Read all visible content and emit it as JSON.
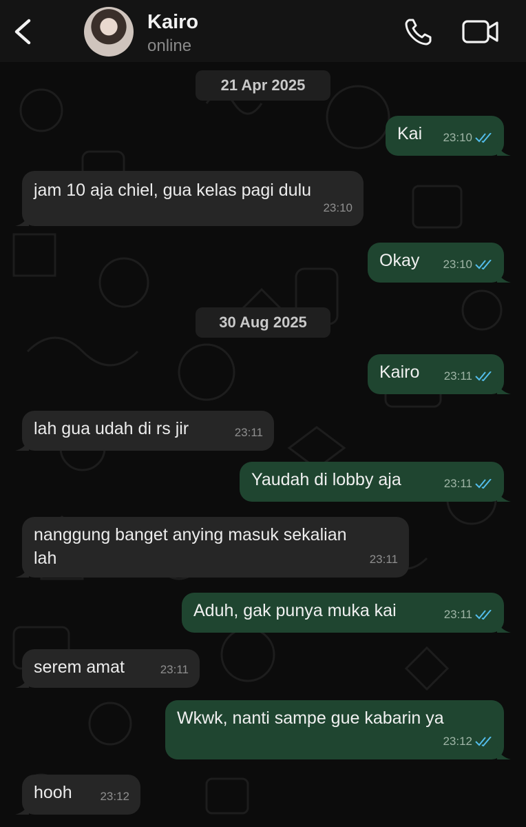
{
  "header": {
    "contact_name": "Kairo",
    "status": "online",
    "back_icon": "chevron-left-icon",
    "call_icon": "phone-icon",
    "video_icon": "video-camera-icon"
  },
  "colors": {
    "outgoing_bubble": "#1f4530",
    "incoming_bubble": "#262626",
    "read_tick": "#53bdeb"
  },
  "dates": [
    "21 Apr 2025",
    "30 Aug 2025"
  ],
  "messages": [
    {
      "dir": "out",
      "text": "Kai",
      "time": "23:10",
      "read": true
    },
    {
      "dir": "in",
      "text": "jam 10 aja chiel, gua kelas pagi dulu",
      "time": "23:10"
    },
    {
      "dir": "out",
      "text": "Okay",
      "time": "23:10",
      "read": true
    },
    {
      "dir": "out",
      "text": "Kairo",
      "time": "23:11",
      "read": true
    },
    {
      "dir": "in",
      "text": "lah gua udah di rs jir",
      "time": "23:11"
    },
    {
      "dir": "out",
      "text": "Yaudah di lobby aja",
      "time": "23:11",
      "read": true
    },
    {
      "dir": "in",
      "text": "nanggung banget anying masuk sekalian",
      "text2": "lah",
      "time": "23:11"
    },
    {
      "dir": "out",
      "text": "Aduh, gak punya muka kai",
      "time": "23:11",
      "read": true
    },
    {
      "dir": "in",
      "text": "serem amat",
      "time": "23:11"
    },
    {
      "dir": "out",
      "text": "Wkwk, nanti sampe gue kabarin ya",
      "time": "23:12",
      "read": true
    },
    {
      "dir": "in",
      "text": "hooh",
      "time": "23:12"
    }
  ]
}
